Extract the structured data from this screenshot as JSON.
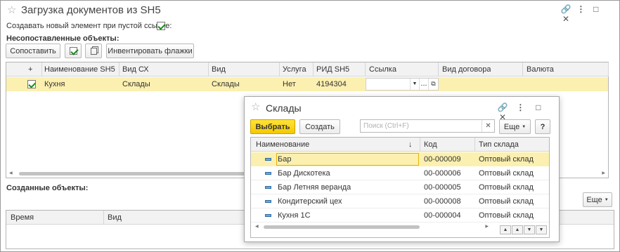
{
  "window": {
    "title": "Загрузка документов из SH5",
    "create_label": "Создавать новый элемент при пустой ссылке:",
    "unmatched_label": "Несопоставленные объекты:",
    "created_label": "Созданные объекты:"
  },
  "toolbar": {
    "match_label": "Сопоставить",
    "invert_label": "Инвентировать флажки",
    "more_label": "Еще"
  },
  "top_grid": {
    "headers": [
      "+",
      "Наименование SH5",
      "Вид СХ",
      "Вид",
      "Услуга",
      "РИД SH5",
      "Ссылка",
      "Вид договора",
      "Валюта"
    ],
    "row": {
      "name": "Кухня",
      "vid_sx": "Склады",
      "vid": "Склады",
      "service": "Нет",
      "rid": "4194304",
      "link": ""
    }
  },
  "bottom_grid": {
    "headers": [
      "Время",
      "Вид"
    ]
  },
  "dialog": {
    "title": "Склады",
    "select_label": "Выбрать",
    "create_label": "Создать",
    "search_placeholder": "Поиск (Ctrl+F)",
    "more_label": "Еще",
    "help_label": "?",
    "headers": [
      "Наименование",
      "Код",
      "Тип склада"
    ],
    "rows": [
      {
        "name": "Бар",
        "code": "00-000009",
        "type": "Оптовый склад"
      },
      {
        "name": "Бар Дискотека",
        "code": "00-000006",
        "type": "Оптовый склад"
      },
      {
        "name": "Бар Летняя веранда",
        "code": "00-000005",
        "type": "Оптовый склад"
      },
      {
        "name": "Кондитерский цех",
        "code": "00-000008",
        "type": "Оптовый склад"
      },
      {
        "name": "Кухня 1С",
        "code": "00-000004",
        "type": "Оптовый склад"
      }
    ]
  },
  "colors": {
    "selected_row": "#fbf0b0",
    "accent_yellow": "#f5c900",
    "check_green": "#1a8a1a"
  }
}
